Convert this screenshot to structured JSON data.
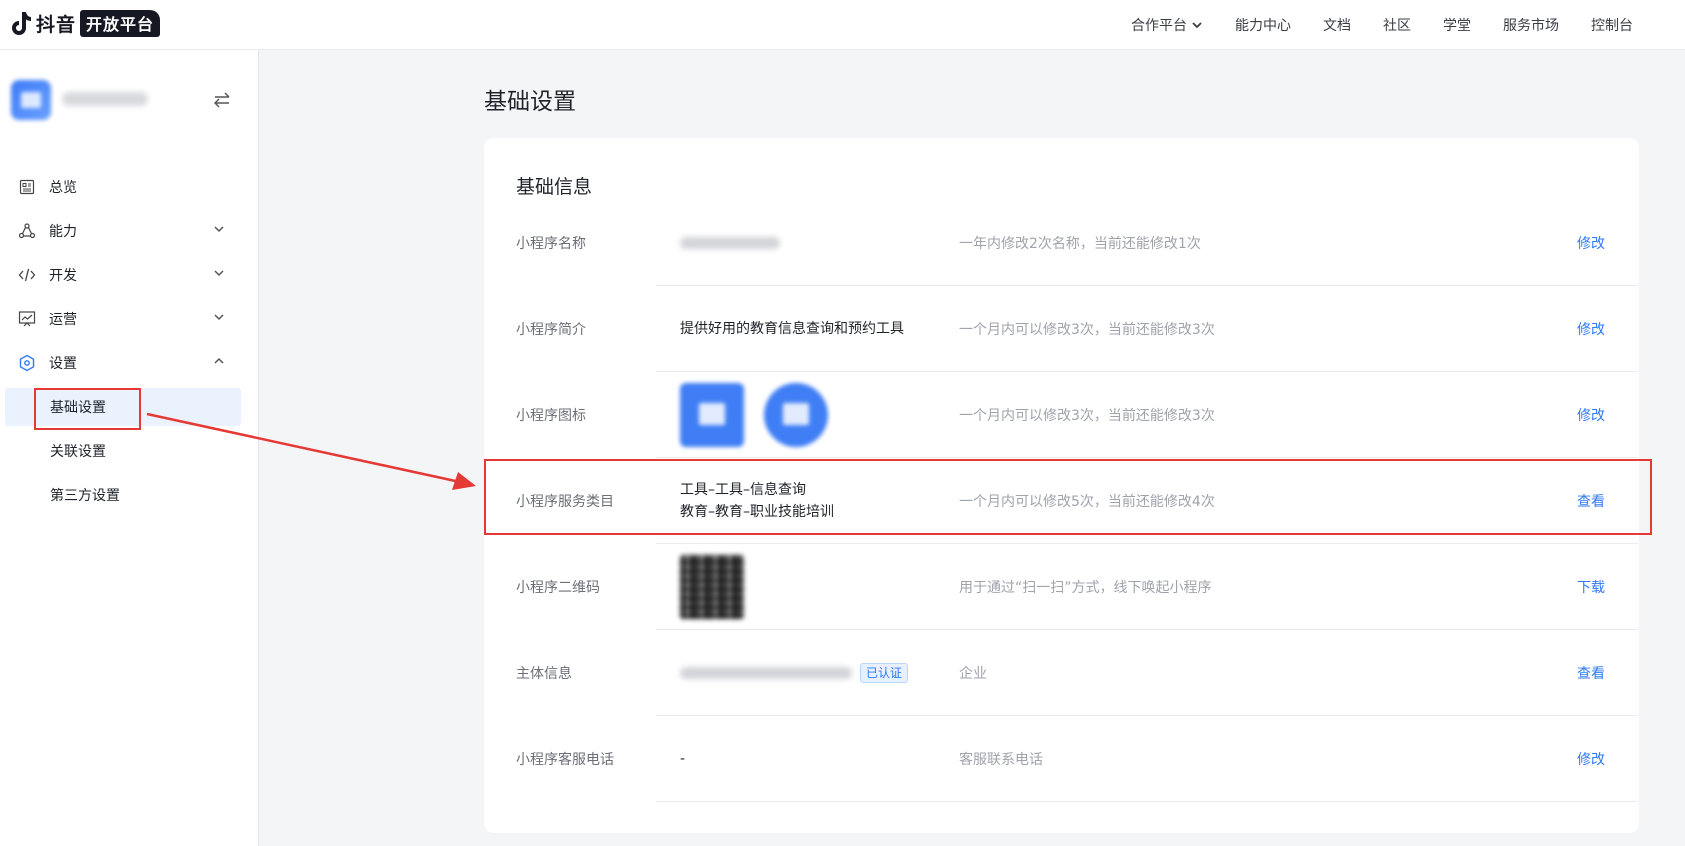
{
  "header": {
    "logo_text": "抖音",
    "logo_badge": "开放平台",
    "nav": [
      {
        "label": "合作平台",
        "has_dropdown": true
      },
      {
        "label": "能力中心"
      },
      {
        "label": "文档"
      },
      {
        "label": "社区"
      },
      {
        "label": "学堂"
      },
      {
        "label": "服务市场"
      },
      {
        "label": "控制台"
      }
    ]
  },
  "sidebar": {
    "items": [
      {
        "label": "总览",
        "icon": "overview-icon"
      },
      {
        "label": "能力",
        "icon": "capability-icon",
        "expandable": true
      },
      {
        "label": "开发",
        "icon": "code-icon",
        "expandable": true
      },
      {
        "label": "运营",
        "icon": "chart-icon",
        "expandable": true
      },
      {
        "label": "设置",
        "icon": "settings-icon",
        "expanded": true
      }
    ],
    "sub_items": [
      {
        "label": "基础设置",
        "active": true
      },
      {
        "label": "关联设置"
      },
      {
        "label": "第三方设置"
      }
    ]
  },
  "main": {
    "page_title": "基础设置",
    "section_title": "基础信息",
    "rows": [
      {
        "label": "小程序名称",
        "value": "",
        "hint": "一年内修改2次名称，当前还能修改1次",
        "action": "修改"
      },
      {
        "label": "小程序简介",
        "value": "提供好用的教育信息查询和预约工具",
        "hint": "一个月内可以修改3次，当前还能修改3次",
        "action": "修改"
      },
      {
        "label": "小程序图标",
        "value": "",
        "hint": "一个月内可以修改3次，当前还能修改3次",
        "action": "修改"
      },
      {
        "label": "小程序服务类目",
        "value_lines": [
          "工具–工具–信息查询",
          "教育–教育–职业技能培训"
        ],
        "hint": "一个月内可以修改5次，当前还能修改4次",
        "action": "查看"
      },
      {
        "label": "小程序二维码",
        "value": "",
        "hint": "用于通过“扫一扫”方式，线下唤起小程序",
        "action": "下载"
      },
      {
        "label": "主体信息",
        "value": "",
        "badge": "已认证",
        "hint": "企业",
        "action": "查看"
      },
      {
        "label": "小程序客服电话",
        "value": "-",
        "hint": "客服联系电话",
        "action": "修改"
      }
    ]
  },
  "colors": {
    "accent": "#2f7af5",
    "annotation": "#e53935",
    "active_bg": "#eaf3fd"
  }
}
